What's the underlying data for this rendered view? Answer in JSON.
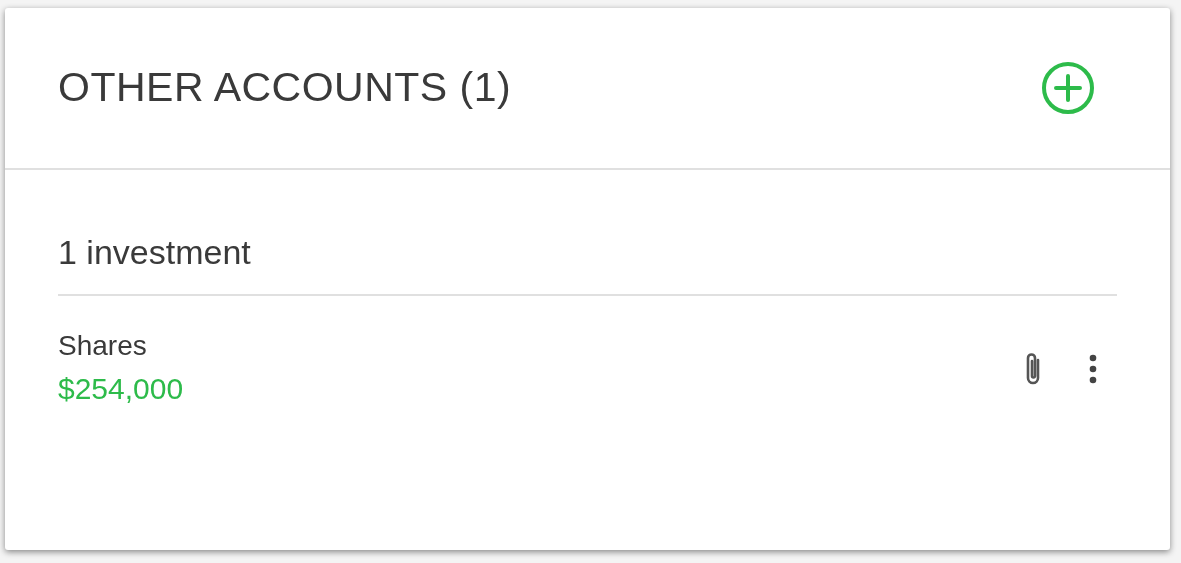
{
  "card": {
    "title": "OTHER ACCOUNTS (1)"
  },
  "section": {
    "heading": "1 investment"
  },
  "items": [
    {
      "name": "Shares",
      "value": "$254,000"
    }
  ]
}
